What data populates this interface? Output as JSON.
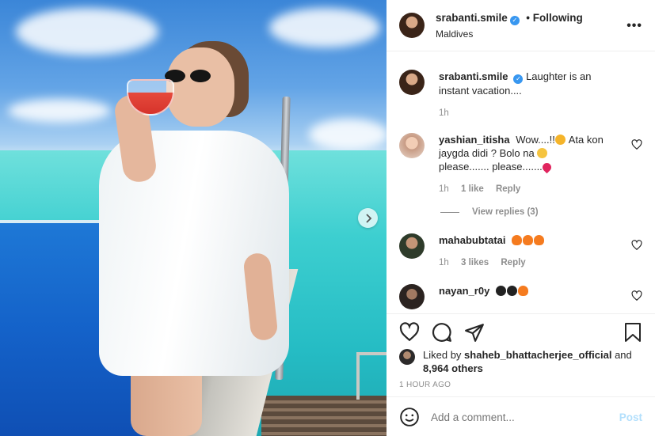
{
  "post": {
    "username": "srabanti.smile",
    "follow_status": "Following",
    "location": "Maldives",
    "more_label": "•••"
  },
  "caption": {
    "username": "srabanti.smile",
    "text": "Laughter is an instant vacation....",
    "time": "1h"
  },
  "comments": [
    {
      "username": "yashian_itisha",
      "text_1": "Wow....!!",
      "text_2": "Ata kon jaygda didi ? Bolo na",
      "text_3": "please....... please.......",
      "time": "1h",
      "likes": "1 like",
      "reply": "Reply",
      "view_replies": "View replies (3)"
    },
    {
      "username": "mahabubtatai",
      "text": "",
      "time": "1h",
      "likes": "3 likes",
      "reply": "Reply"
    },
    {
      "username": "nayan_r0y",
      "text": ""
    }
  ],
  "likes": {
    "prefix": "Liked by",
    "user": "shaheb_bhattacherjee_official",
    "joiner": "and",
    "count": "8,964 others"
  },
  "timestamp": "1 HOUR AGO",
  "composer": {
    "placeholder": "Add a comment...",
    "post_label": "Post"
  },
  "colors": {
    "verified": "#3897f0",
    "post_disabled": "#b2dffc",
    "muted": "#8e8e8e"
  }
}
